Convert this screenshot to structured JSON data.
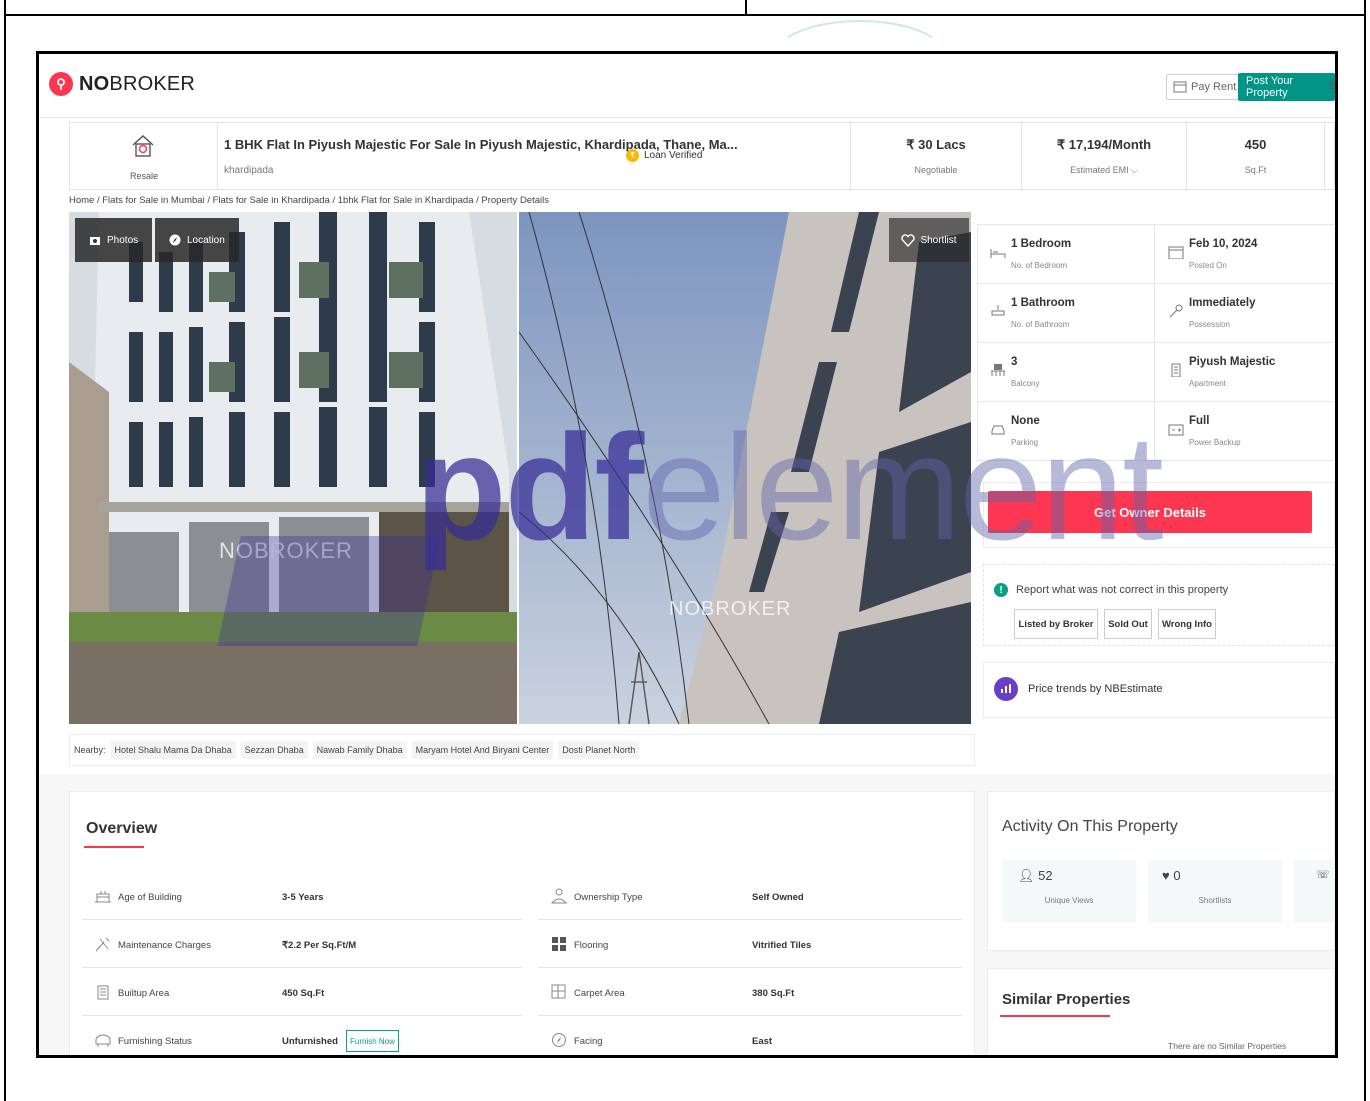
{
  "nav": {
    "brand_bold": "NO",
    "brand_rest": "BROKER",
    "pay_rent": "Pay Rent",
    "post_property": "Post Your Property",
    "cut_text": "S"
  },
  "header": {
    "type_label": "Resale",
    "title": "1 BHK Flat In Piyush Majestic For Sale In Piyush Majestic, Khardipada, Thane, Ma...",
    "locality": "khardipada",
    "loan_badge": "Loan Verified",
    "price": "₹ 30 Lacs",
    "price_sub": "Negotiable",
    "emi": "₹ 17,194/Month",
    "emi_sub": "Estimated EMI ⌵",
    "area": "450",
    "area_sub": "Sq.Ft"
  },
  "breadcrumb": "Home / Flats for Sale in Mumbai / Flats for Sale in Khardipada / 1bhk Flat for Sale in Khardipada / Property Details",
  "photos": {
    "photos_btn": "Photos",
    "location_btn": "Location",
    "shortlist_btn": "Shortlist",
    "watermark": "NOBROKER"
  },
  "nearby": {
    "label": "Nearby:",
    "places": [
      "Hotel Shalu Mama Da Dhaba",
      "Sezzan Dhaba",
      "Nawab Family Dhaba",
      "Maryam Hotel And Biryani Center",
      "Dosti Planet North"
    ]
  },
  "specs": [
    {
      "value": "1 Bedroom",
      "label": "No. of Bedroom",
      "icon": "bed-icon"
    },
    {
      "value": "Feb 10, 2024",
      "label": "Posted On",
      "icon": "calendar-icon"
    },
    {
      "value": "1 Bathroom",
      "label": "No. of Bathroom",
      "icon": "bathtub-icon"
    },
    {
      "value": "Immediately",
      "label": "Possession",
      "icon": "key-icon"
    },
    {
      "value": "3",
      "label": "Balcony",
      "icon": "balcony-icon"
    },
    {
      "value": "Piyush Majestic",
      "label": "Apartment",
      "icon": "building-icon"
    },
    {
      "value": "None",
      "label": "Parking",
      "icon": "car-icon"
    },
    {
      "value": "Full",
      "label": "Power Backup",
      "icon": "power-icon"
    }
  ],
  "owner": {
    "button": "Get Owner Details"
  },
  "report": {
    "title": "Report what was not correct in this property",
    "buttons": [
      "Listed by Broker",
      "Sold Out",
      "Wrong Info"
    ]
  },
  "trends": {
    "label": "Price trends by NBEstimate"
  },
  "overview": {
    "title": "Overview",
    "rows": [
      {
        "label": "Age of Building",
        "value": "3-5 Years",
        "icon": "building-age-icon"
      },
      {
        "label": "Ownership Type",
        "value": "Self Owned",
        "icon": "ownership-icon"
      },
      {
        "label": "Maintenance Charges",
        "value": "₹2.2 Per Sq.Ft/M",
        "icon": "tools-icon"
      },
      {
        "label": "Flooring",
        "value": "Vitrified Tiles",
        "icon": "tiles-icon"
      },
      {
        "label": "Builtup Area",
        "value": "450 Sq.Ft",
        "icon": "builtup-icon"
      },
      {
        "label": "Carpet Area",
        "value": "380 Sq.Ft",
        "icon": "carpet-icon"
      },
      {
        "label": "Furnishing Status",
        "value": "Unfurnished",
        "icon": "sofa-icon"
      },
      {
        "label": "Facing",
        "value": "East",
        "icon": "compass-icon"
      }
    ],
    "furnish_now": "Furnish Now"
  },
  "activity": {
    "title": "Activity On This Property",
    "views": "52",
    "views_label": "Unique Views",
    "shortlists": "0",
    "shortlists_label": "Shortlists"
  },
  "similar": {
    "title": "Similar Properties",
    "empty": "There are no Similar Properties"
  },
  "watermark": {
    "part1": "pdf",
    "part2": "element"
  },
  "colors": {
    "brand_red": "#fd3752",
    "teal": "#009587",
    "purple": "#6a3fc8"
  }
}
